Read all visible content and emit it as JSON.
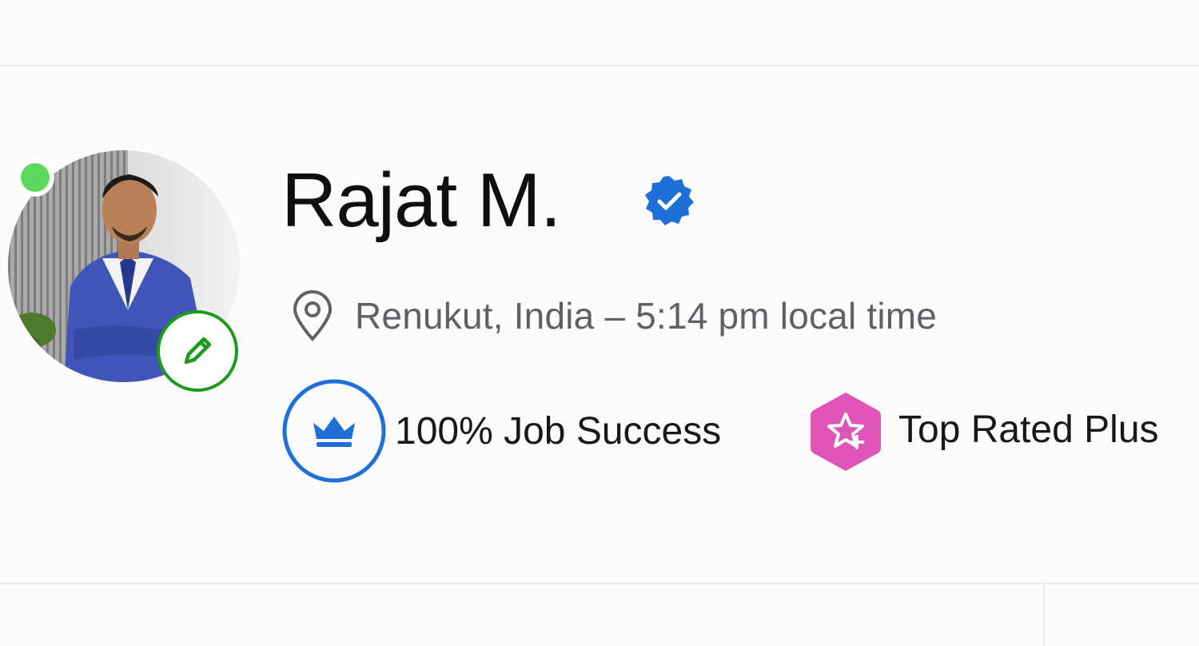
{
  "profile": {
    "name": "Rajat M.",
    "location_text": "Renukut, India – 5:14 pm local time",
    "online_status": "online",
    "verified": true
  },
  "badges": {
    "job_success_label": "100% Job Success",
    "top_rated_label": "Top Rated Plus"
  },
  "icons": {
    "online": "online-status-dot",
    "edit": "pencil-icon",
    "verified": "verified-check-icon",
    "location": "map-pin-icon",
    "job_success": "crown-icon",
    "top_rated": "star-badge-icon"
  },
  "colors": {
    "online_green": "#5ed85c",
    "edit_green": "#1c9a1c",
    "verified_blue": "#1f6fd9",
    "job_success_blue": "#1f6fd9",
    "top_rated_pink": "#e054b8",
    "text_dark": "#0f0f10",
    "text_muted": "#606066"
  }
}
